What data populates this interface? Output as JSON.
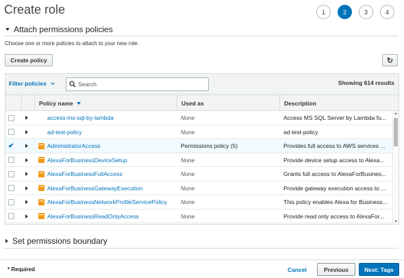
{
  "header": {
    "title": "Create role",
    "steps": [
      "1",
      "2",
      "3",
      "4"
    ],
    "active_step": "2"
  },
  "attach_section": {
    "title": "Attach permissions policies",
    "subtitle": "Choose one or more policies to attach to your new role.",
    "create_policy_label": "Create policy",
    "refresh_icon": "refresh-icon"
  },
  "toolbar": {
    "filter_label": "Filter policies",
    "search_placeholder": "Search",
    "showing": "Showing 614 results"
  },
  "table": {
    "headers": {
      "policy_name": "Policy name",
      "used_as": "Used as",
      "description": "Description"
    },
    "rows": [
      {
        "checked": false,
        "icon": false,
        "name": "access-ms-sql-by-lambda",
        "used_as": "None",
        "description": "Access MS SQL Server by Lambda fu..."
      },
      {
        "checked": false,
        "icon": false,
        "name": "ad-test-policy",
        "used_as": "None",
        "description": "ad-test-policy"
      },
      {
        "checked": true,
        "icon": true,
        "name": "AdministratorAccess",
        "used_as": "Permissions policy (5)",
        "description": "Provides full access to AWS services ..."
      },
      {
        "checked": false,
        "icon": true,
        "name": "AlexaForBusinessDeviceSetup",
        "used_as": "None",
        "description": "Provide device setup access to Alexa..."
      },
      {
        "checked": false,
        "icon": true,
        "name": "AlexaForBusinessFullAccess",
        "used_as": "None",
        "description": "Grants full access to AlexaForBusines..."
      },
      {
        "checked": false,
        "icon": true,
        "name": "AlexaForBusinessGatewayExecution",
        "used_as": "None",
        "description": "Provide gateway execution access to ..."
      },
      {
        "checked": false,
        "icon": true,
        "name": "AlexaForBusinessNetworkProfileServicePolicy",
        "used_as": "None",
        "description": "This policy enables Alexa for Business..."
      },
      {
        "checked": false,
        "icon": true,
        "name": "AlexaForBusinessReadOnlyAccess",
        "used_as": "None",
        "description": "Provide read only access to AlexaFor..."
      }
    ]
  },
  "boundary_section": {
    "title": "Set permissions boundary"
  },
  "footer": {
    "required": "* Required",
    "cancel": "Cancel",
    "previous": "Previous",
    "next": "Next: Tags"
  },
  "colors": {
    "accent": "#0073bb",
    "policy_icon": "#f09a1a",
    "primary_button": "#0073bb"
  }
}
